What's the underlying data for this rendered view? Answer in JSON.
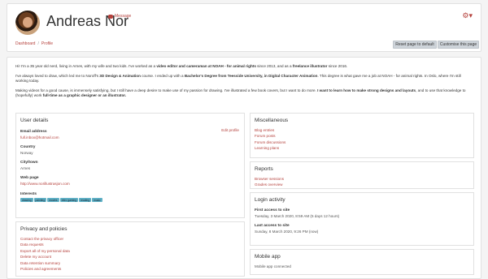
{
  "header": {
    "name": "Andreas Nor",
    "message_label": "Message",
    "breadcrumb": [
      "Dashboard",
      "/",
      "Profile"
    ],
    "reset_label": "Reset page to default",
    "customise_label": "Customise this page"
  },
  "description": [
    [
      {
        "t": "Hi! I'm a 35 year old nerd, living in Arnes, with my wife and two kids. I've worked as a ",
        "b": false
      },
      {
        "t": "video editor and cameraman at NOAH - for animal rights",
        "b": true
      },
      {
        "t": " since 2013, and as a ",
        "b": false
      },
      {
        "t": "freelance illustrator",
        "b": true
      },
      {
        "t": " since 2016.",
        "b": false
      }
    ],
    [
      {
        "t": "I've always loved to draw, which led me to Noroff's ",
        "b": false
      },
      {
        "t": "3D Design & Animation",
        "b": true
      },
      {
        "t": " course. I ended up with a ",
        "b": false
      },
      {
        "t": "Bachelor's Degree from Teesside University, in Digital Character Animation",
        "b": true
      },
      {
        "t": ". This degree is what gave me a job at NOAH - for animal rights. In Oslo, where I'm still working today.",
        "b": false
      }
    ],
    [
      {
        "t": "Making videos for a good cause, is immensely satisfying, but I still have a deep desire to make use of my passion for drawing. I've illustrated a few book covers, but I want to do more. ",
        "b": false
      },
      {
        "t": "I want to learn how to make strong designs and layouts",
        "b": true
      },
      {
        "t": ", and to use that knowledge to (hopefully) work ",
        "b": false
      },
      {
        "t": "full-time as a graphic designer or an illustrator.",
        "b": true
      }
    ]
  ],
  "user_details": {
    "title": "User details",
    "edit_label": "Edit profile",
    "email_label": "Email address",
    "email": "full.inbox@hotmail.com",
    "country_label": "Country",
    "country": "Norway",
    "city_label": "City/town",
    "city": "Arnes",
    "webpage_label": "Web page",
    "webpage": "http://www.norillustrasjon.com",
    "interests_label": "Interests",
    "interests": [
      "drawing",
      "painting",
      "movies",
      "retro gaming",
      "reading",
      "music"
    ]
  },
  "privacy": {
    "title": "Privacy and policies",
    "links": [
      "Contact the privacy officer",
      "Data requests",
      "Export all of my personal data",
      "Delete my account",
      "Data retention summary",
      "Policies and agreements"
    ]
  },
  "misc": {
    "title": "Miscellaneous",
    "links": [
      "Blog entries",
      "Forum posts",
      "Forum discussions",
      "Learning plans"
    ]
  },
  "reports": {
    "title": "Reports",
    "links": [
      "Browser sessions",
      "Grades overview"
    ]
  },
  "login": {
    "title": "Login activity",
    "first_label": "First access to site",
    "first_value": "Tuesday, 3 March 2020, 8:59 AM  (5 days 12 hours)",
    "last_label": "Last access to site",
    "last_value": "Sunday, 8 March 2020, 9:26 PM  (now)"
  },
  "mobile": {
    "title": "Mobile app",
    "status": "Mobile app connected"
  },
  "icons": {
    "message": "speech-bubble-icon",
    "settings": "gear-icon"
  },
  "colors": {
    "accent": "#b5413c",
    "tag": "#5fb0c5"
  }
}
